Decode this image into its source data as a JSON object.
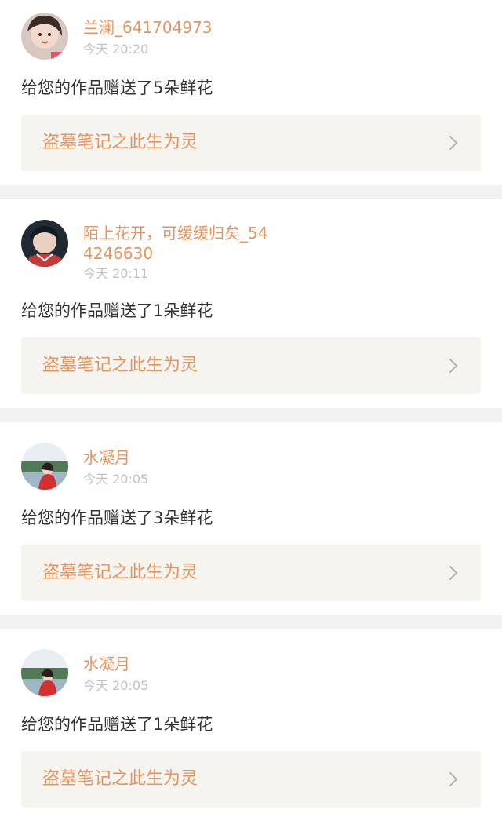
{
  "notifications": [
    {
      "username": "兰澜_641704973",
      "time": "今天 20:20",
      "message": "给您的作品赠送了5朵鲜花",
      "work_title": "盗墓笔记之此生为灵",
      "avatar_icon": "user-avatar-icon"
    },
    {
      "username": "陌上花开，可缓缓归矣_544246630",
      "time": "今天 20:11",
      "message": "给您的作品赠送了1朵鲜花",
      "work_title": "盗墓笔记之此生为灵",
      "avatar_icon": "user-avatar-icon"
    },
    {
      "username": "水凝月",
      "time": "今天 20:05",
      "message": "给您的作品赠送了3朵鲜花",
      "work_title": "盗墓笔记之此生为灵",
      "avatar_icon": "user-avatar-icon"
    },
    {
      "username": "水凝月",
      "time": "今天 20:05",
      "message": "给您的作品赠送了1朵鲜花",
      "work_title": "盗墓笔记之此生为灵",
      "avatar_icon": "user-avatar-icon"
    }
  ],
  "colors": {
    "accent": "#e6945f",
    "timestamp": "#c2c2c2",
    "text": "#333333",
    "link_bg": "#f5f4ee",
    "separator": "#f2f2f2"
  }
}
